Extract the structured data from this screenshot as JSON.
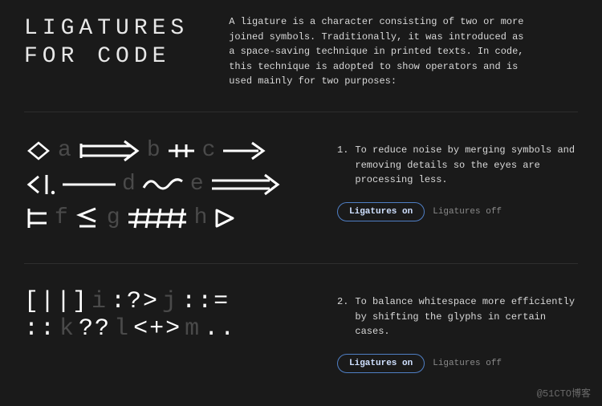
{
  "heading_line1": "LIGATURES",
  "heading_line2": "FOR CODE",
  "intro": "A ligature is a character consisting of two or more joined symbols. Traditionally, it was introduced as a space-saving technique in printed texts. In code, this technique is adopted to show operators and is used mainly for two purposes:",
  "section1": {
    "number": "1.",
    "text": "To reduce noise by merging symbols and removing details so the eyes are processing less.",
    "toggle_on": "Ligatures on",
    "toggle_off": "Ligatures off",
    "ghosts_row1": [
      "a",
      "b",
      "c"
    ],
    "ghosts_row2": [
      "d",
      "e"
    ],
    "ghosts_row3": [
      "f",
      "g",
      "h"
    ]
  },
  "section2": {
    "number": "2.",
    "text": "To balance whitespace more efficiently by shifting the glyphs in certain cases.",
    "toggle_on": "Ligatures on",
    "toggle_off": "Ligatures off",
    "row1": {
      "g1": "[||]",
      "ghost1": "i",
      "g2": ":?>",
      "ghost2": "j",
      "g3": "::="
    },
    "row2": {
      "g1": "::",
      "ghost1": "k",
      "g2": "??",
      "ghost2": "l",
      "g3": "<+>",
      "ghost3": "m",
      "g4": ".."
    }
  },
  "watermark": "@51CTO博客"
}
